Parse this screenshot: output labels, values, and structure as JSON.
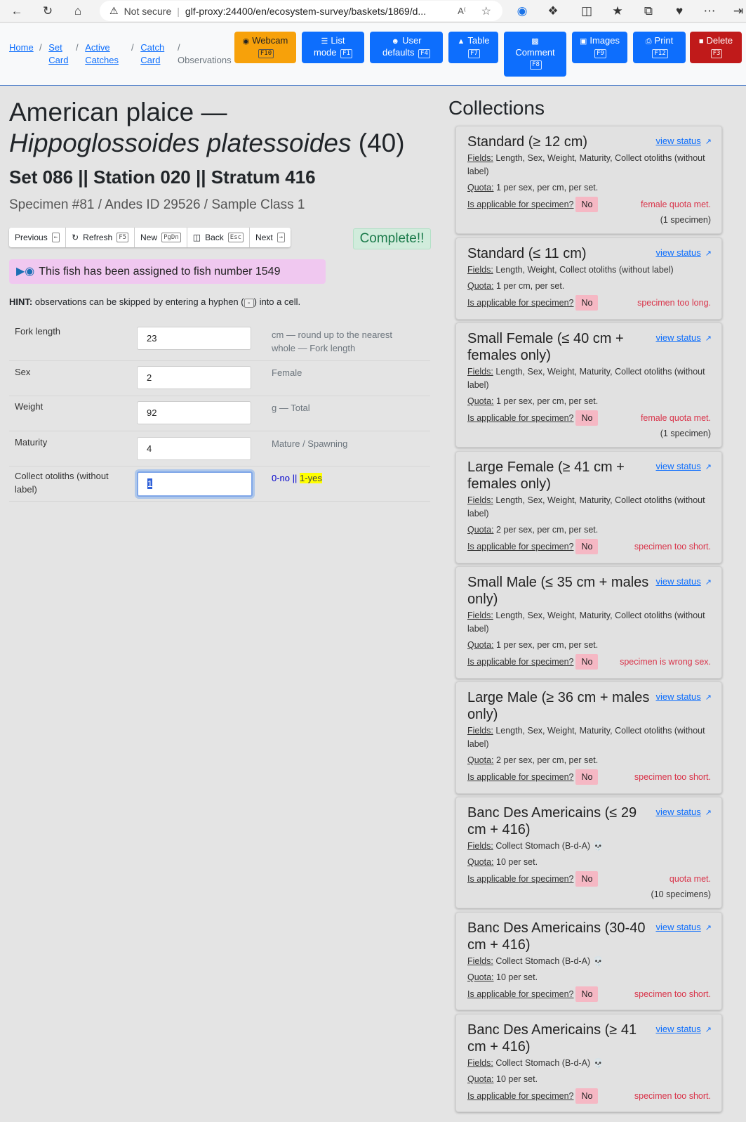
{
  "browser": {
    "security": "Not secure",
    "url": "glf-proxy:24400/en/ecosystem-survey/baskets/1869/d..."
  },
  "breadcrumb": [
    {
      "label": "Home"
    },
    {
      "label": "Set Card"
    },
    {
      "label": "Active Catches"
    },
    {
      "label": "Catch Card"
    },
    {
      "label": "Observations"
    }
  ],
  "toolbar": {
    "webcam": {
      "label": "Webcam",
      "key": "F10",
      "color": "#f7a10a"
    },
    "list_mode": {
      "label1": "List",
      "label2": "mode",
      "key": "F1"
    },
    "user_defaults": {
      "label1": "User",
      "label2": "defaults",
      "key": "F4"
    },
    "table": {
      "label": "Table",
      "key": "F7"
    },
    "comment": {
      "label": "Comment",
      "key": "F8"
    },
    "images": {
      "label": "Images",
      "key": "F9"
    },
    "print": {
      "label": "Print",
      "key": "F12"
    },
    "delete": {
      "label": "Delete",
      "key": "F3",
      "color": "#c01a1a"
    }
  },
  "header": {
    "common_name": "American plaice —",
    "scientific_name": "Hippoglossoides platessoides",
    "count": "(40)",
    "set_line": "Set 086 || Station 020 || Stratum 416",
    "specimen_line": "Specimen #81 / Andes ID 29526 / Sample Class 1"
  },
  "nav": {
    "previous": {
      "label": "Previous",
      "key": "←"
    },
    "refresh": {
      "label": "Refresh",
      "key": "F5"
    },
    "new": {
      "label": "New",
      "key": "PgDn"
    },
    "back": {
      "label": "Back",
      "key": "Esc"
    },
    "next": {
      "label": "Next",
      "key": "→"
    }
  },
  "complete_text": "Complete!!",
  "assigned_text": "This fish has been assigned to fish number 1549",
  "hint": {
    "bold": "HINT:",
    "pre": "observations can be skipped by entering a hyphen (",
    "key": "-",
    "post": ") into a cell."
  },
  "fields": [
    {
      "label": "Fork length",
      "value": "23",
      "help": "cm — round up to the nearest whole — Fork length"
    },
    {
      "label": "Sex",
      "value": "2",
      "help": "Female"
    },
    {
      "label": "Weight",
      "value": "92",
      "help": "g — Total"
    },
    {
      "label": "Maturity",
      "value": "4",
      "help": "Mature / Spawning"
    },
    {
      "label": "Collect otoliths (without label)",
      "value": "1",
      "help_no": "0-no",
      "help_sep": "||",
      "help_yes": "1-yes"
    }
  ],
  "collections_title": "Collections",
  "collections": [
    {
      "title": "Standard (≥ 12 cm)",
      "fields": "Length, Sex, Weight, Maturity, Collect otoliths (without label)",
      "quota": "1 per sex, per cm, per set.",
      "reason": "female quota met.",
      "count": "(1 specimen)"
    },
    {
      "title": "Standard (≤ 11 cm)",
      "fields": "Length, Weight, Collect otoliths (without label)",
      "quota": "1 per cm, per set.",
      "reason": "specimen too long."
    },
    {
      "title": "Small Female (≤ 40 cm + females only)",
      "fields": "Length, Sex, Weight, Maturity, Collect otoliths (without label)",
      "quota": "1 per sex, per cm, per set.",
      "reason": "female quota met.",
      "count": "(1 specimen)"
    },
    {
      "title": "Large Female (≥ 41 cm + females only)",
      "fields": "Length, Sex, Weight, Maturity, Collect otoliths (without label)",
      "quota": "2 per sex, per cm, per set.",
      "reason": "specimen too short."
    },
    {
      "title": "Small Male (≤ 35 cm + males only)",
      "fields": "Length, Sex, Weight, Maturity, Collect otoliths (without label)",
      "quota": "1 per sex, per cm, per set.",
      "reason": "specimen is wrong sex."
    },
    {
      "title": "Large Male (≥ 36 cm + males only)",
      "fields": "Length, Sex, Weight, Maturity, Collect otoliths (without label)",
      "quota": "2 per sex, per cm, per set.",
      "reason": "specimen too short."
    },
    {
      "title": "Banc Des Americains (≤ 29 cm + 416)",
      "fields": "Collect Stomach (B-d-A) 💀",
      "quota": "10 per set.",
      "reason": "quota met.",
      "count": "(10 specimens)"
    },
    {
      "title": "Banc Des Americains (30-40 cm + 416)",
      "fields": "Collect Stomach (B-d-A) 💀",
      "quota": "10 per set.",
      "reason": "specimen too short."
    },
    {
      "title": "Banc Des Americains (≥ 41 cm + 416)",
      "fields": "Collect Stomach (B-d-A) 💀",
      "quota": "10 per set.",
      "reason": "specimen too short."
    }
  ],
  "collection_labels": {
    "view_status": "view status",
    "fields": "Fields:",
    "quota": "Quota:",
    "applicable": "Is applicable for specimen?",
    "no": "No"
  }
}
